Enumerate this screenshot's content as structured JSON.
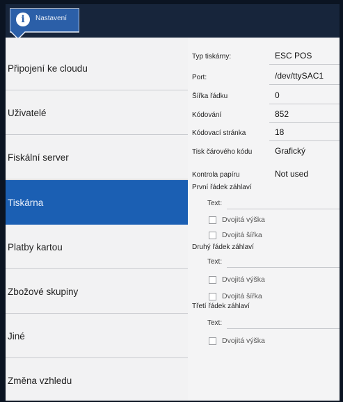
{
  "header": {
    "title": "Nastavení",
    "info_glyph": "i"
  },
  "sidebar": {
    "items": [
      {
        "label": "Připojení ke cloudu"
      },
      {
        "label": "Uživatelé"
      },
      {
        "label": "Fiskální server"
      },
      {
        "label": "Tiskárna",
        "active": true
      },
      {
        "label": "Platby kartou"
      },
      {
        "label": "Zbožové skupiny"
      },
      {
        "label": "Jiné"
      },
      {
        "label": "Změna vzhledu"
      }
    ]
  },
  "printer": {
    "fields": [
      {
        "label": "Typ tiskárny:",
        "value": "ESC POS"
      },
      {
        "label": "Port:",
        "value": "/dev/ttySAC1"
      },
      {
        "label": "Šířka řádku",
        "value": "0"
      },
      {
        "label": "Kódování",
        "value": "852"
      },
      {
        "label": "Kódovací stránka",
        "value": "18"
      },
      {
        "label": "Tisk čárového kódu",
        "value": "Grafický"
      },
      {
        "label": "Kontrola papíru",
        "value": "Not used"
      }
    ],
    "header_lines": [
      {
        "title": "První řádek záhlaví",
        "text_label": "Text:",
        "double_height": "Dvojitá výška",
        "double_width": "Dvojitá šířka"
      },
      {
        "title": "Druhý řádek záhlaví",
        "text_label": "Text:",
        "double_height": "Dvojitá výška",
        "double_width": "Dvojitá šířka"
      },
      {
        "title": "Třetí řádek záhlaví",
        "text_label": "Text:",
        "double_height": "Dvojitá výška"
      }
    ]
  },
  "colors": {
    "active": "#1b5fb3",
    "header": "#17253b"
  }
}
